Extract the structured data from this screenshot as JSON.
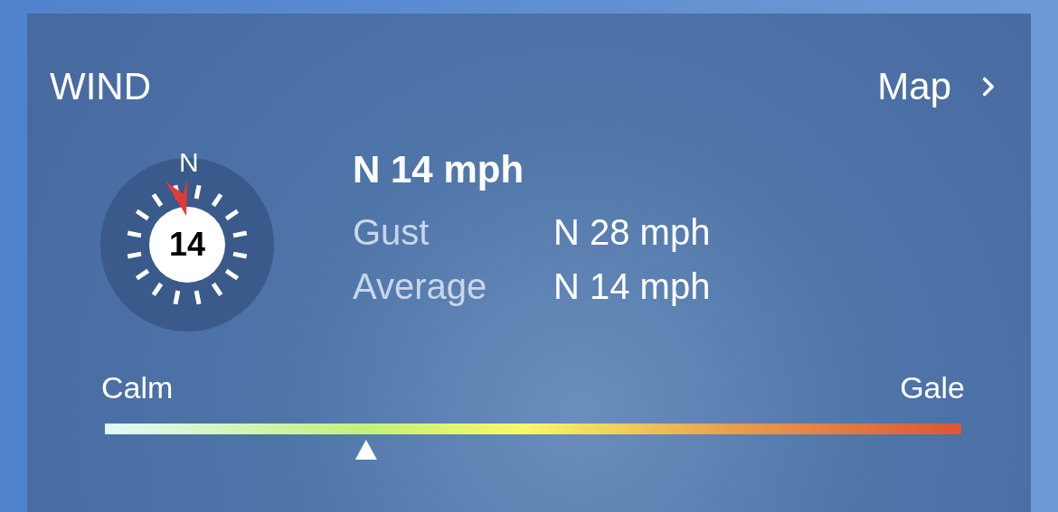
{
  "card": {
    "title": "WIND",
    "link": {
      "label": "Map"
    }
  },
  "compass": {
    "north_label": "N",
    "speed": "14"
  },
  "summary": {
    "headline": "N 14 mph",
    "details": [
      {
        "label": "Gust",
        "value": "N 28 mph"
      },
      {
        "label": "Average",
        "value": "N 14 mph"
      }
    ]
  },
  "scale": {
    "min_label": "Calm",
    "max_label": "Gale",
    "level": 0.305
  }
}
